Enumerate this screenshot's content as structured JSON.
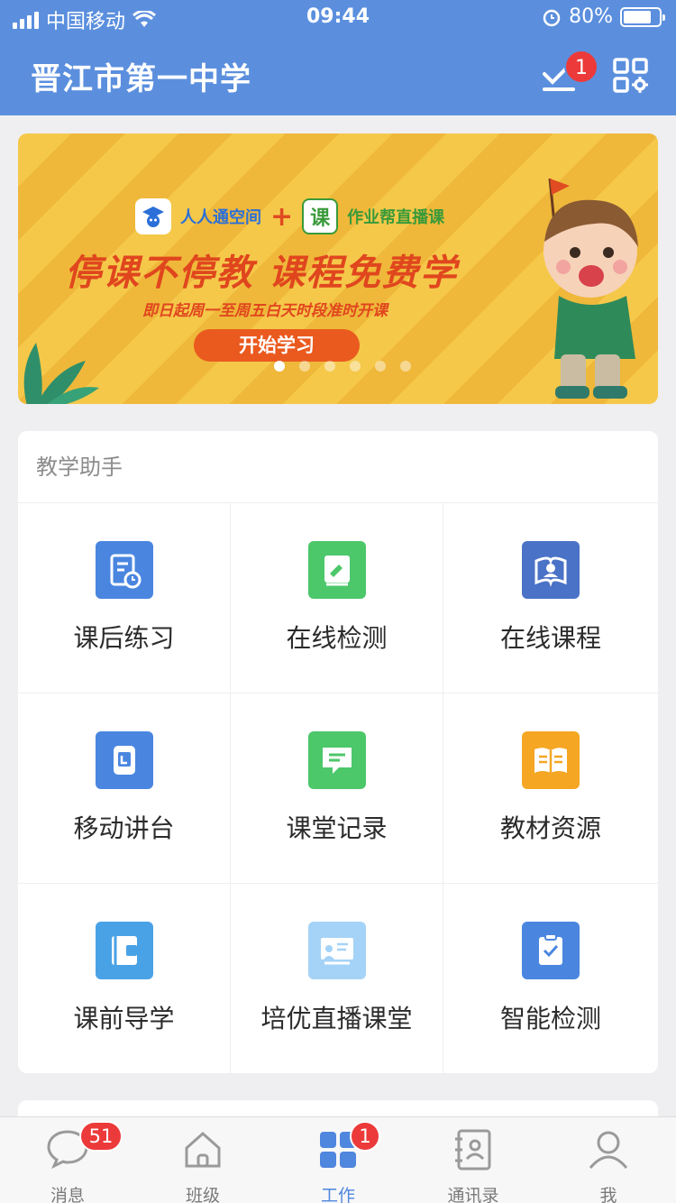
{
  "status_bar": {
    "carrier": "中国移动",
    "time": "09:44",
    "battery": "80%",
    "battery_level": 0.8
  },
  "header": {
    "title": "晋江市第一中学",
    "todo_badge": "1"
  },
  "banner": {
    "brand1": "人人通空间",
    "plus": "+",
    "brand2_logo": "课",
    "brand2": "作业帮直播课",
    "headline": "停课不停教  课程免费学",
    "subline": "即日起周一至周五白天时段准时开课",
    "cta": "开始学习",
    "slide_count": 6,
    "active_slide": 1
  },
  "assistant": {
    "title": "教学助手",
    "items": [
      {
        "label": "课后练习",
        "icon": "homework-icon",
        "color": "#4a86e0"
      },
      {
        "label": "在线检测",
        "icon": "online-test-icon",
        "color": "#4cc76a"
      },
      {
        "label": "在线课程",
        "icon": "online-course-icon",
        "color": "#4a72c6"
      },
      {
        "label": "移动讲台",
        "icon": "mobile-podium-icon",
        "color": "#4a86e0"
      },
      {
        "label": "课堂记录",
        "icon": "class-record-icon",
        "color": "#4cc76a"
      },
      {
        "label": "教材资源",
        "icon": "textbook-icon",
        "color": "#f5a623"
      },
      {
        "label": "课前导学",
        "icon": "preview-guide-icon",
        "color": "#4aa2e6"
      },
      {
        "label": "培优直播课堂",
        "icon": "live-class-icon",
        "color": "#a5d3f7"
      },
      {
        "label": "智能检测",
        "icon": "smart-test-icon",
        "color": "#4a86e0"
      }
    ]
  },
  "tabbar": {
    "tabs": [
      {
        "label": "消息",
        "badge": "51"
      },
      {
        "label": "班级",
        "badge": ""
      },
      {
        "label": "工作",
        "badge": "1"
      },
      {
        "label": "通讯录",
        "badge": ""
      },
      {
        "label": "我",
        "badge": ""
      }
    ],
    "active_tab": "工作"
  },
  "colors": {
    "header": "#5b8fde",
    "badge": "#ec3a3a",
    "active_tab": "#4f86de"
  }
}
